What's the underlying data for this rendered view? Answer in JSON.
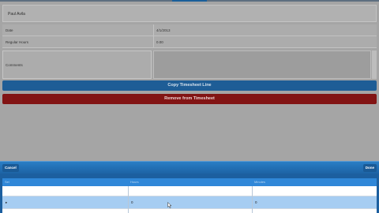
{
  "app": {
    "person_name": "Paul Avila"
  },
  "form": {
    "date_label": "Date",
    "date_value": "4/1/2013",
    "hours_label": "Regular Hours",
    "hours_value": "0.00",
    "comments_label": "Comments",
    "comments_value": ""
  },
  "actions": {
    "copy_label": "Copy Timesheet Line",
    "remove_label": "Remove from Timesheet"
  },
  "picker": {
    "cancel_label": "Cancel",
    "done_label": "Done",
    "columns": [
      "Sel",
      "Hours",
      "Minutes"
    ],
    "blank_row": [
      "",
      "",
      ""
    ],
    "selected_row": [
      "▸",
      "0",
      "0"
    ]
  },
  "colors": {
    "accent_blue": "#1e5d96",
    "danger_red": "#821414",
    "selected_row": "#a6cdf2"
  }
}
